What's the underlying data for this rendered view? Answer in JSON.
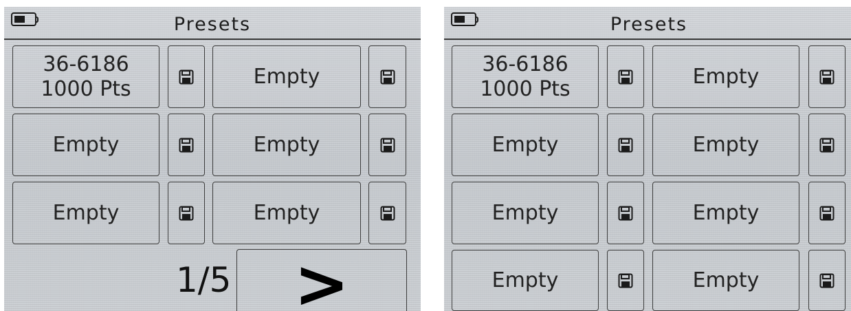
{
  "screens": [
    {
      "title": "Presets",
      "presets": [
        {
          "lines": [
            "36-6186",
            "1000 Pts"
          ]
        },
        {
          "lines": [
            "Empty"
          ]
        },
        {
          "lines": [
            "Empty"
          ]
        },
        {
          "lines": [
            "Empty"
          ]
        },
        {
          "lines": [
            "Empty"
          ]
        },
        {
          "lines": [
            "Empty"
          ]
        }
      ],
      "page_indicator": "1/5",
      "next_label": ">"
    },
    {
      "title": "Presets",
      "presets": [
        {
          "lines": [
            "36-6186",
            "1000 Pts"
          ]
        },
        {
          "lines": [
            "Empty"
          ]
        },
        {
          "lines": [
            "Empty"
          ]
        },
        {
          "lines": [
            "Empty"
          ]
        },
        {
          "lines": [
            "Empty"
          ]
        },
        {
          "lines": [
            "Empty"
          ]
        },
        {
          "lines": [
            "Empty"
          ]
        },
        {
          "lines": [
            "Empty"
          ]
        }
      ]
    }
  ],
  "icons": {
    "battery": "battery-icon",
    "save": "floppy-disk-icon"
  },
  "colors": {
    "screen_background": "#c8ccd0",
    "border": "#3c3c3c",
    "text": "#222222"
  }
}
